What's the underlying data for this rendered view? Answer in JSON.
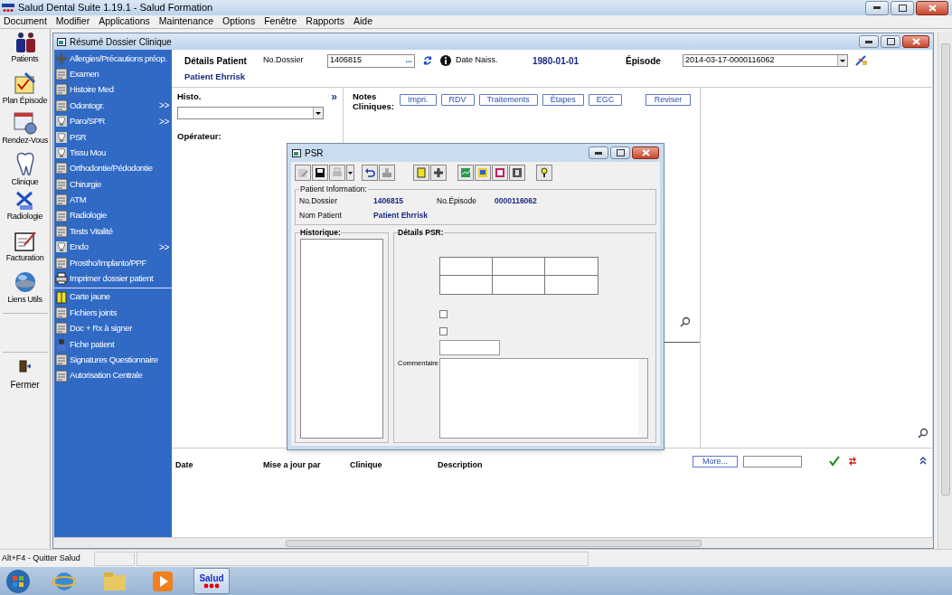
{
  "app_window": {
    "title": "Salud Dental Suite 1.19.1 - Salud Formation"
  },
  "menu": [
    "Document",
    "Modifier",
    "Applications",
    "Maintenance",
    "Options",
    "Fenêtre",
    "Rapports",
    "Aide"
  ],
  "toolbar": [
    {
      "label": "Patients",
      "kind": "people"
    },
    {
      "label": "Plan Épisode",
      "kind": "plan"
    },
    {
      "label": "Rendez-Vous",
      "kind": "calendar"
    },
    {
      "label": "Clinique",
      "kind": "tooth"
    },
    {
      "label": "Radiologie",
      "kind": "xray"
    },
    {
      "label": "Facturation",
      "kind": "invoice"
    },
    {
      "label": "Liens Utils",
      "kind": "globe"
    }
  ],
  "close_tool": {
    "label": "Fermer"
  },
  "child_window": {
    "title": "Résumé Dossier Clinique"
  },
  "sidebar": {
    "items": [
      {
        "label": "Allergies/Précautions préop.",
        "kind": "plus"
      },
      {
        "label": "Examen",
        "kind": "doc"
      },
      {
        "label": "Histoire Med",
        "kind": "doc"
      },
      {
        "label": "Odontogr.",
        "kind": "doc",
        "arrow": ">>"
      },
      {
        "label": "Paro/SPR",
        "kind": "tooth",
        "arrow": ">>"
      },
      {
        "label": "PSR",
        "kind": "tooth"
      },
      {
        "label": "Tissu Mou",
        "kind": "tooth"
      },
      {
        "label": "Orthodontie/Pédodontie",
        "kind": "doc"
      },
      {
        "label": "Chirurgie",
        "kind": "doc"
      },
      {
        "label": "ATM",
        "kind": "doc"
      },
      {
        "label": "Radiologie",
        "kind": "doc"
      },
      {
        "label": "Tests Vitalité",
        "kind": "doc"
      },
      {
        "label": "Endo",
        "kind": "tooth",
        "arrow": ">>"
      },
      {
        "label": "Prostho/Implanto/PPF",
        "kind": "doc"
      },
      {
        "label": "Imprimer dossier patient",
        "kind": "print"
      }
    ],
    "items_2": [
      {
        "label": "Carte jaune",
        "kind": "card"
      },
      {
        "label": "Fichiers joints",
        "kind": "doc"
      },
      {
        "label": "Doc + Rx à signer",
        "kind": "doc"
      },
      {
        "label": "Fiche patient",
        "kind": "person"
      },
      {
        "label": "Signatures Questionnaire",
        "kind": "doc"
      },
      {
        "label": "Autorisation Centrale",
        "kind": "doc"
      }
    ]
  },
  "patient": {
    "details_label": "Détails Patient",
    "dossier_label": "No.Dossier",
    "dossier_value": "1406815",
    "browse": "...",
    "birth_label": "Date Naiss.",
    "birth_value": "1980-01-01",
    "episode_label": "Épisode",
    "episode_value": "2014-03-17-0000116062",
    "name": "Patient Ehrrisk"
  },
  "histo": {
    "label": "Histo.",
    "expand": "»",
    "operator_label": "Opérateur:"
  },
  "notes": {
    "label": "Notes Cliniques:",
    "buttons": [
      "Impri.",
      "RDV",
      "Traitements",
      "Étapes",
      "EGC"
    ],
    "revise": "Reviser"
  },
  "history_table": {
    "columns": [
      "Date",
      "Mise a jour par",
      "Clinique",
      "Description"
    ],
    "more": "More..."
  },
  "psr_dialog": {
    "title": "PSR",
    "patient_info_label": "Patient Information:",
    "fields": [
      {
        "label": "No.Dossier",
        "value": "1406815"
      },
      {
        "label": "No.Épisode",
        "value": "0000116062"
      },
      {
        "label": "Nom Patient",
        "value": "Patient Ehrrisk"
      }
    ],
    "history_label": "Historique:",
    "details_label": "Détails PSR:",
    "checkboxes": [
      {
        "checked": false
      },
      {
        "checked": false
      }
    ],
    "comment_label": "Commentaire"
  },
  "status_bar": {
    "hint": "Alt+F4 - Quitter Salud"
  },
  "taskbar": {
    "app": "Salud"
  }
}
